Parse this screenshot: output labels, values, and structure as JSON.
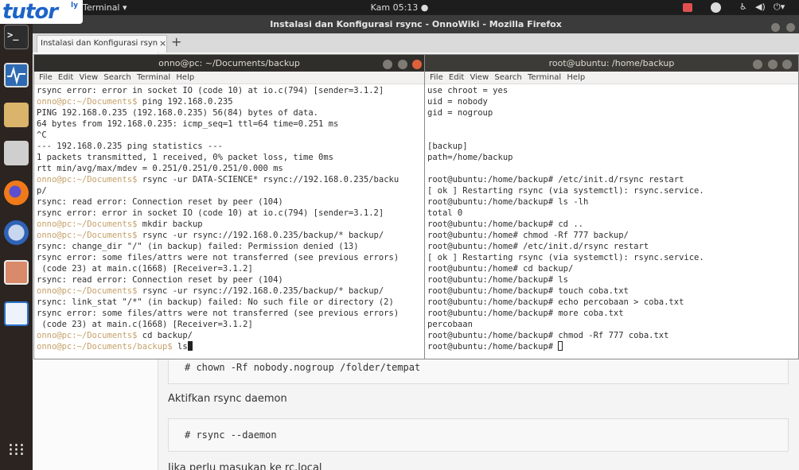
{
  "topbar": {
    "app_menu": "Terminal ▾",
    "clock": "Kam 05:13 ●",
    "tray_icons": [
      "camera-icon",
      "user-icon",
      "accessibility-icon",
      "volume-icon",
      "power-icon"
    ]
  },
  "logo": {
    "text": "tutor",
    "suffix": "ly"
  },
  "dock": {
    "items": [
      "terminal-icon",
      "system-monitor-icon",
      "text-editor-icon",
      "scanner-icon",
      "firefox-icon",
      "thunderbird-icon",
      "files-icon",
      "writer-icon",
      "show-apps-icon"
    ]
  },
  "firefox": {
    "title": "Instalasi dan Konfigurasi rsync - OnnoWiki - Mozilla Firefox",
    "tab_label": "Instalasi dan Konfigurasi rsync",
    "tab_close": "×",
    "new_tab": "+",
    "page": {
      "code1": "# chown -Rf nobody.nogroup /folder/tempat",
      "text1": "Aktifkan rsync daemon",
      "code2": "# rsync --daemon",
      "text2": "Jika perlu masukan ke rc.local"
    }
  },
  "term_left": {
    "title": "onno@pc: ~/Documents/backup",
    "menu": [
      "File",
      "Edit",
      "View",
      "Search",
      "Terminal",
      "Help"
    ],
    "lines": [
      {
        "p": "",
        "t": "rsync error: error in socket IO (code 10) at io.c(794) [sender=3.1.2]"
      },
      {
        "p": "onno@pc:~/Documents$",
        "t": " ping 192.168.0.235"
      },
      {
        "p": "",
        "t": "PING 192.168.0.235 (192.168.0.235) 56(84) bytes of data."
      },
      {
        "p": "",
        "t": "64 bytes from 192.168.0.235: icmp_seq=1 ttl=64 time=0.251 ms"
      },
      {
        "p": "",
        "t": "^C"
      },
      {
        "p": "",
        "t": "--- 192.168.0.235 ping statistics ---"
      },
      {
        "p": "",
        "t": "1 packets transmitted, 1 received, 0% packet loss, time 0ms"
      },
      {
        "p": "",
        "t": "rtt min/avg/max/mdev = 0.251/0.251/0.251/0.000 ms"
      },
      {
        "p": "onno@pc:~/Documents$",
        "t": " rsync -ur DATA-SCIENCE* rsync://192.168.0.235/backu"
      },
      {
        "p": "",
        "t": "p/"
      },
      {
        "p": "",
        "t": "rsync: read error: Connection reset by peer (104)"
      },
      {
        "p": "",
        "t": "rsync error: error in socket IO (code 10) at io.c(794) [sender=3.1.2]"
      },
      {
        "p": "onno@pc:~/Documents$",
        "t": " mkdir backup"
      },
      {
        "p": "onno@pc:~/Documents$",
        "t": " rsync -ur rsync://192.168.0.235/backup/* backup/"
      },
      {
        "p": "",
        "t": "rsync: change_dir \"/\" (in backup) failed: Permission denied (13)"
      },
      {
        "p": "",
        "t": "rsync error: some files/attrs were not transferred (see previous errors)"
      },
      {
        "p": "",
        "t": " (code 23) at main.c(1668) [Receiver=3.1.2]"
      },
      {
        "p": "",
        "t": "rsync: read error: Connection reset by peer (104)"
      },
      {
        "p": "onno@pc:~/Documents$",
        "t": " rsync -ur rsync://192.168.0.235/backup/* backup/"
      },
      {
        "p": "",
        "t": "rsync: link_stat \"/*\" (in backup) failed: No such file or directory (2)"
      },
      {
        "p": "",
        "t": "rsync error: some files/attrs were not transferred (see previous errors)"
      },
      {
        "p": "",
        "t": " (code 23) at main.c(1668) [Receiver=3.1.2]"
      },
      {
        "p": "onno@pc:~/Documents$",
        "t": " cd backup/"
      },
      {
        "p": "onno@pc:~/Documents/backup$",
        "t": " ls"
      }
    ]
  },
  "term_right": {
    "title": "root@ubuntu: /home/backup",
    "menu": [
      "File",
      "Edit",
      "View",
      "Search",
      "Terminal",
      "Help"
    ],
    "lines": [
      {
        "p": "",
        "t": "use chroot = yes"
      },
      {
        "p": "",
        "t": "uid = nobody"
      },
      {
        "p": "",
        "t": "gid = nogroup"
      },
      {
        "p": "",
        "t": ""
      },
      {
        "p": "",
        "t": ""
      },
      {
        "p": "",
        "t": "[backup]"
      },
      {
        "p": "",
        "t": "path=/home/backup"
      },
      {
        "p": "",
        "t": ""
      },
      {
        "p": "",
        "t": "root@ubuntu:/home/backup# /etc/init.d/rsync restart"
      },
      {
        "p": "",
        "t": "[ ok ] Restarting rsync (via systemctl): rsync.service."
      },
      {
        "p": "",
        "t": "root@ubuntu:/home/backup# ls -lh"
      },
      {
        "p": "",
        "t": "total 0"
      },
      {
        "p": "",
        "t": "root@ubuntu:/home/backup# cd .."
      },
      {
        "p": "",
        "t": "root@ubuntu:/home# chmod -Rf 777 backup/"
      },
      {
        "p": "",
        "t": "root@ubuntu:/home# /etc/init.d/rsync restart"
      },
      {
        "p": "",
        "t": "[ ok ] Restarting rsync (via systemctl): rsync.service."
      },
      {
        "p": "",
        "t": "root@ubuntu:/home# cd backup/"
      },
      {
        "p": "",
        "t": "root@ubuntu:/home/backup# ls"
      },
      {
        "p": "",
        "t": "root@ubuntu:/home/backup# touch coba.txt"
      },
      {
        "p": "",
        "t": "root@ubuntu:/home/backup# echo percobaan > coba.txt"
      },
      {
        "p": "",
        "t": "root@ubuntu:/home/backup# more coba.txt"
      },
      {
        "p": "",
        "t": "percobaan"
      },
      {
        "p": "",
        "t": "root@ubuntu:/home/backup# chmod -Rf 777 coba.txt"
      },
      {
        "p": "",
        "t": "root@ubuntu:/home/backup# "
      }
    ]
  }
}
